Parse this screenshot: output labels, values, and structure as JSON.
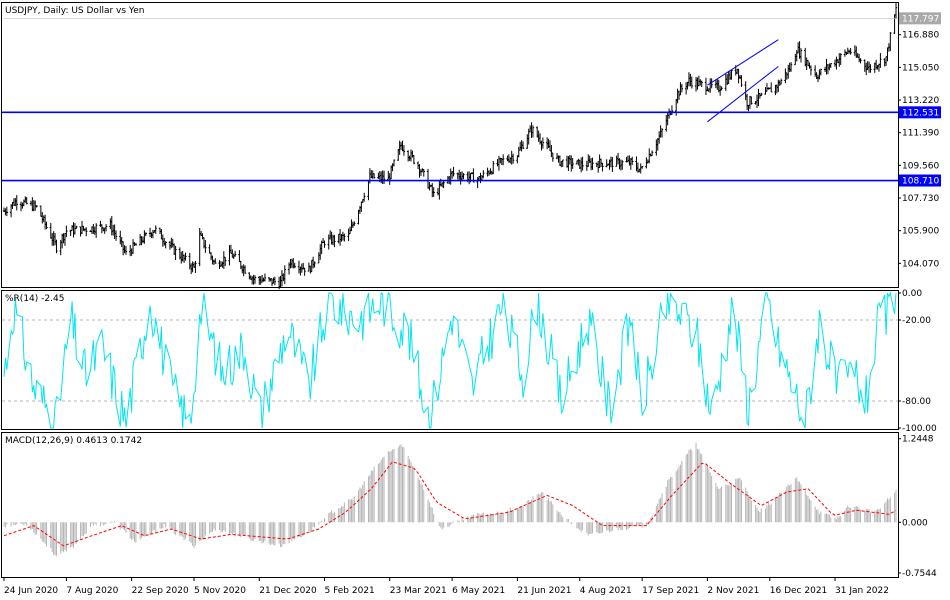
{
  "colors": {
    "background": "#ffffff",
    "frame": "#000000",
    "bars": "#000000",
    "hline": "#0000ff",
    "channel": "#0000ff",
    "wpr": "#00e5ee",
    "wpr_levels": "#a0a0a0",
    "macd_hist": "#b4b4b4",
    "macd_signal": "#ff0000",
    "badge_grey": "#a9a9a9",
    "badge_blue": "#0000ff"
  },
  "chart_data": [
    {
      "type": "ohlc",
      "title": "USDJPY, Daily:  US Dollar vs Yen",
      "price_ticks": [
        "116.880",
        "115.050",
        "113.220",
        "111.390",
        "109.560",
        "107.730",
        "105.900",
        "104.070"
      ],
      "ylim": [
        102.8,
        118.6
      ],
      "current_price_label": "117.797",
      "horizontal_levels": [
        {
          "label": "112.531",
          "value": 112.531
        },
        {
          "label": "108.710",
          "value": 108.71
        }
      ],
      "channel": {
        "upper": [
          [
            "2021-11-02",
            114.05
          ],
          [
            "2021-12-22",
            116.6
          ]
        ],
        "lower": [
          [
            "2021-11-02",
            112.0
          ],
          [
            "2021-12-22",
            115.1
          ]
        ]
      },
      "close_keypoints": [
        [
          "2020-06-24",
          107.0
        ],
        [
          "2020-07-03",
          107.6
        ],
        [
          "2020-07-17",
          107.2
        ],
        [
          "2020-07-31",
          105.0
        ],
        [
          "2020-08-07",
          105.9
        ],
        [
          "2020-08-21",
          106.0
        ],
        [
          "2020-09-07",
          106.2
        ],
        [
          "2020-09-18",
          104.6
        ],
        [
          "2020-10-08",
          106.0
        ],
        [
          "2020-10-22",
          104.8
        ],
        [
          "2020-11-05",
          103.8
        ],
        [
          "2020-11-09",
          105.6
        ],
        [
          "2020-11-20",
          104.0
        ],
        [
          "2020-12-01",
          104.6
        ],
        [
          "2020-12-17",
          103.2
        ],
        [
          "2021-01-05",
          103.0
        ],
        [
          "2021-01-12",
          104.2
        ],
        [
          "2021-01-25",
          103.7
        ],
        [
          "2021-02-05",
          105.3
        ],
        [
          "2021-02-22",
          105.6
        ],
        [
          "2021-03-09",
          108.9
        ],
        [
          "2021-03-22",
          108.8
        ],
        [
          "2021-03-31",
          110.7
        ],
        [
          "2021-04-12",
          109.6
        ],
        [
          "2021-04-23",
          107.9
        ],
        [
          "2021-05-06",
          109.1
        ],
        [
          "2021-05-25",
          108.8
        ],
        [
          "2021-06-10",
          109.8
        ],
        [
          "2021-06-21",
          110.2
        ],
        [
          "2021-07-01",
          111.6
        ],
        [
          "2021-07-20",
          109.8
        ],
        [
          "2021-08-05",
          109.6
        ],
        [
          "2021-08-20",
          109.7
        ],
        [
          "2021-09-09",
          109.7
        ],
        [
          "2021-09-16",
          109.3
        ],
        [
          "2021-09-30",
          111.3
        ],
        [
          "2021-10-12",
          113.6
        ],
        [
          "2021-10-20",
          114.3
        ],
        [
          "2021-11-01",
          114.0
        ],
        [
          "2021-11-10",
          113.9
        ],
        [
          "2021-11-23",
          115.0
        ],
        [
          "2021-11-30",
          113.1
        ],
        [
          "2021-12-10",
          113.4
        ],
        [
          "2021-12-22",
          114.1
        ],
        [
          "2021-12-31",
          115.1
        ],
        [
          "2022-01-04",
          116.1
        ],
        [
          "2022-01-18",
          114.6
        ],
        [
          "2022-01-28",
          115.2
        ],
        [
          "2022-02-10",
          116.0
        ],
        [
          "2022-02-24",
          115.0
        ],
        [
          "2022-03-08",
          115.6
        ],
        [
          "2022-03-15",
          118.3
        ]
      ]
    },
    {
      "type": "line",
      "name": "%R(14) -2.45",
      "ylim": [
        -100,
        0
      ],
      "levels": [
        -20,
        -80
      ],
      "ticks": [
        "0.00",
        "-20.00",
        "-80.00",
        "-100.00"
      ],
      "keypoints": [
        [
          "2020-06-24",
          -60
        ],
        [
          "2020-07-01",
          -10
        ],
        [
          "2020-07-15",
          -70
        ],
        [
          "2020-07-31",
          -95
        ],
        [
          "2020-08-10",
          -20
        ],
        [
          "2020-08-20",
          -60
        ],
        [
          "2020-09-01",
          -40
        ],
        [
          "2020-09-18",
          -95
        ],
        [
          "2020-10-05",
          -5
        ],
        [
          "2020-10-20",
          -70
        ],
        [
          "2020-11-02",
          -98
        ],
        [
          "2020-11-10",
          -10
        ],
        [
          "2020-11-25",
          -60
        ],
        [
          "2020-12-10",
          -40
        ],
        [
          "2020-12-22",
          -90
        ],
        [
          "2021-01-10",
          -25
        ],
        [
          "2021-01-25",
          -70
        ],
        [
          "2021-02-08",
          -5
        ],
        [
          "2021-03-01",
          -20
        ],
        [
          "2021-03-17",
          -5
        ],
        [
          "2021-04-05",
          -30
        ],
        [
          "2021-04-20",
          -95
        ],
        [
          "2021-05-06",
          -15
        ],
        [
          "2021-05-20",
          -70
        ],
        [
          "2021-06-10",
          -10
        ],
        [
          "2021-06-25",
          -60
        ],
        [
          "2021-07-05",
          -5
        ],
        [
          "2021-07-22",
          -80
        ],
        [
          "2021-08-10",
          -20
        ],
        [
          "2021-08-25",
          -85
        ],
        [
          "2021-09-10",
          -15
        ],
        [
          "2021-09-16",
          -85
        ],
        [
          "2021-10-05",
          -5
        ],
        [
          "2021-10-25",
          -30
        ],
        [
          "2021-11-05",
          -90
        ],
        [
          "2021-11-20",
          -10
        ],
        [
          "2021-12-01",
          -85
        ],
        [
          "2021-12-14",
          -5
        ],
        [
          "2021-12-22",
          -40
        ],
        [
          "2022-01-10",
          -95
        ],
        [
          "2022-01-20",
          -20
        ],
        [
          "2022-02-01",
          -70
        ],
        [
          "2022-02-14",
          -60
        ],
        [
          "2022-02-22",
          -80
        ],
        [
          "2022-03-01",
          -30
        ],
        [
          "2022-03-15",
          -2.45
        ]
      ]
    },
    {
      "type": "bar+line",
      "name": "MACD(12,26,9) 0.4613 0.1742",
      "ylim": [
        -0.8,
        1.3
      ],
      "ticks": [
        "1.2448",
        "0.000",
        "-0.7544"
      ],
      "macd_keypoints": [
        [
          "2020-06-24",
          -0.05
        ],
        [
          "2020-07-10",
          -0.02
        ],
        [
          "2020-07-31",
          -0.5
        ],
        [
          "2020-08-10",
          -0.4
        ],
        [
          "2020-08-25",
          -0.05
        ],
        [
          "2020-09-10",
          0.0
        ],
        [
          "2020-09-25",
          -0.3
        ],
        [
          "2020-10-15",
          -0.05
        ],
        [
          "2020-11-05",
          -0.35
        ],
        [
          "2020-11-20",
          -0.1
        ],
        [
          "2020-12-15",
          -0.25
        ],
        [
          "2021-01-05",
          -0.35
        ],
        [
          "2021-01-25",
          -0.15
        ],
        [
          "2021-02-10",
          0.15
        ],
        [
          "2021-02-25",
          0.35
        ],
        [
          "2021-03-12",
          0.8
        ],
        [
          "2021-03-22",
          1.05
        ],
        [
          "2021-04-01",
          1.15
        ],
        [
          "2021-04-15",
          0.55
        ],
        [
          "2021-04-28",
          -0.1
        ],
        [
          "2021-05-20",
          0.1
        ],
        [
          "2021-06-10",
          0.15
        ],
        [
          "2021-06-25",
          0.25
        ],
        [
          "2021-07-08",
          0.45
        ],
        [
          "2021-07-25",
          0.05
        ],
        [
          "2021-08-10",
          -0.2
        ],
        [
          "2021-08-30",
          -0.1
        ],
        [
          "2021-09-20",
          -0.05
        ],
        [
          "2021-10-05",
          0.6
        ],
        [
          "2021-10-20",
          1.05
        ],
        [
          "2021-10-25",
          1.15
        ],
        [
          "2021-11-10",
          0.5
        ],
        [
          "2021-11-25",
          0.65
        ],
        [
          "2021-12-08",
          0.15
        ],
        [
          "2021-12-20",
          0.35
        ],
        [
          "2022-01-04",
          0.65
        ],
        [
          "2022-01-20",
          0.15
        ],
        [
          "2022-02-01",
          0.05
        ],
        [
          "2022-02-10",
          0.25
        ],
        [
          "2022-03-01",
          0.15
        ],
        [
          "2022-03-15",
          0.4613
        ]
      ],
      "signal_keypoints": [
        [
          "2020-06-24",
          -0.2
        ],
        [
          "2020-07-15",
          -0.05
        ],
        [
          "2020-08-05",
          -0.35
        ],
        [
          "2020-08-25",
          -0.2
        ],
        [
          "2020-09-15",
          -0.05
        ],
        [
          "2020-10-01",
          -0.2
        ],
        [
          "2020-10-20",
          -0.1
        ],
        [
          "2020-11-10",
          -0.25
        ],
        [
          "2020-12-01",
          -0.18
        ],
        [
          "2021-01-10",
          -0.25
        ],
        [
          "2021-02-01",
          -0.1
        ],
        [
          "2021-02-20",
          0.15
        ],
        [
          "2021-03-10",
          0.5
        ],
        [
          "2021-03-25",
          0.9
        ],
        [
          "2021-04-10",
          0.8
        ],
        [
          "2021-04-25",
          0.3
        ],
        [
          "2021-05-15",
          0.05
        ],
        [
          "2021-06-15",
          0.15
        ],
        [
          "2021-07-12",
          0.4
        ],
        [
          "2021-07-30",
          0.25
        ],
        [
          "2021-08-20",
          -0.05
        ],
        [
          "2021-09-20",
          -0.05
        ],
        [
          "2021-10-08",
          0.4
        ],
        [
          "2021-10-30",
          0.9
        ],
        [
          "2021-11-20",
          0.55
        ],
        [
          "2021-12-10",
          0.25
        ],
        [
          "2021-12-28",
          0.45
        ],
        [
          "2022-01-12",
          0.5
        ],
        [
          "2022-01-30",
          0.1
        ],
        [
          "2022-02-15",
          0.18
        ],
        [
          "2022-03-10",
          0.12
        ],
        [
          "2022-03-15",
          0.1742
        ]
      ]
    }
  ],
  "date_labels": [
    "24 Jun 2020",
    "7 Aug 2020",
    "22 Sep 2020",
    "5 Nov 2020",
    "21 Dec 2020",
    "5 Feb 2021",
    "23 Mar 2021",
    "6 May 2021",
    "21 Jun 2021",
    "4 Aug 2021",
    "17 Sep 2021",
    "2 Nov 2021",
    "16 Dec 2021",
    "31 Jan 2022"
  ],
  "date_ticks": [
    "2020-06-24",
    "2020-08-07",
    "2020-09-22",
    "2020-11-05",
    "2020-12-21",
    "2021-02-05",
    "2021-03-23",
    "2021-05-06",
    "2021-06-21",
    "2021-08-04",
    "2021-09-17",
    "2021-11-02",
    "2021-12-16",
    "2022-01-31"
  ],
  "x_range": [
    "2020-06-24",
    "2022-03-15"
  ]
}
